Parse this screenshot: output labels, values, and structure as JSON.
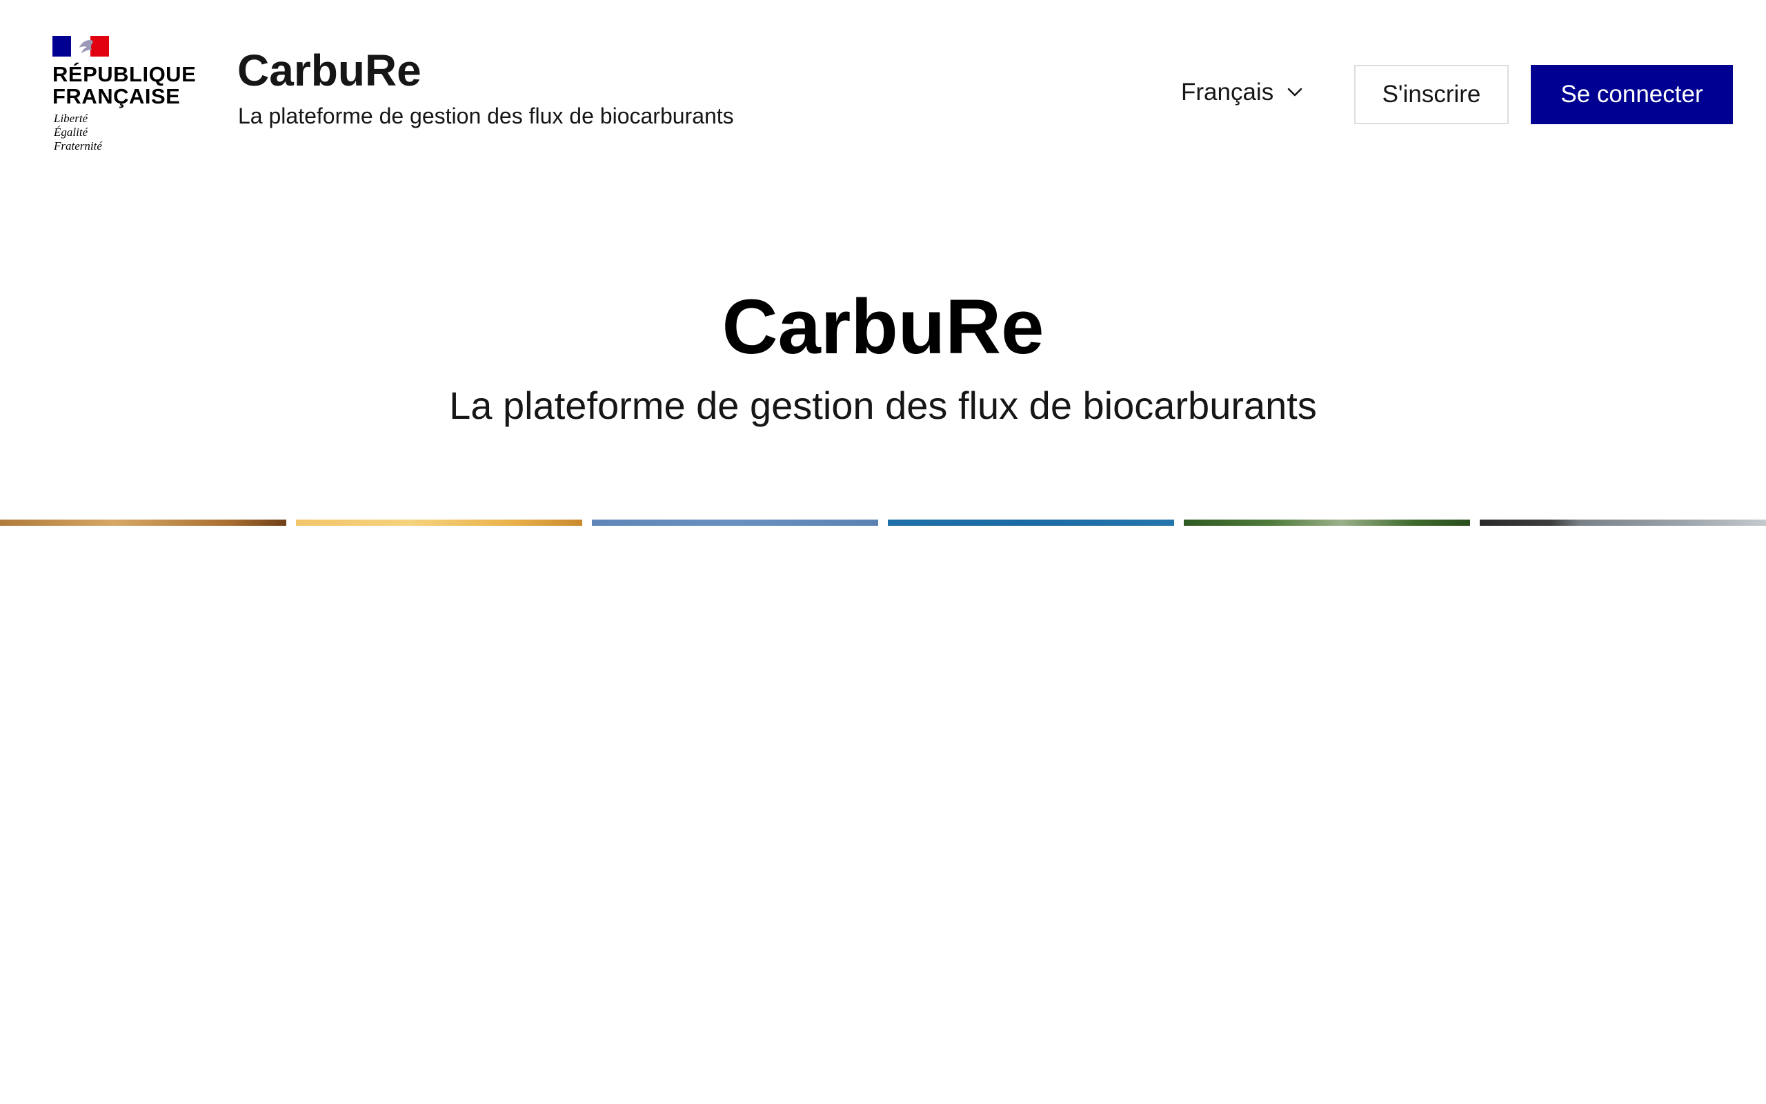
{
  "header": {
    "brand": {
      "line1": "RÉPUBLIQUE",
      "line2": "FRANÇAISE",
      "motto": [
        "Liberté",
        "Égalité",
        "Fraternité"
      ],
      "flag_colors": [
        "#000091",
        "#ffffff",
        "#e1000f"
      ]
    },
    "service_title": "CarbuRe",
    "service_tagline": "La plateforme de gestion des flux de biocarburants",
    "language_selector": {
      "selected": "Français",
      "icon": "chevron-down-icon"
    },
    "register_label": "S'inscrire",
    "login_label": "Se connecter",
    "accent_color": "#000091"
  },
  "hero": {
    "title": "CarbuRe",
    "tagline": "La plateforme de gestion des flux de biocarburants"
  },
  "image_strip": {
    "tiles": [
      {
        "subject": "wood-image"
      },
      {
        "subject": "grain-image"
      },
      {
        "subject": "sky-image"
      },
      {
        "subject": "water-image"
      },
      {
        "subject": "plants-image"
      },
      {
        "subject": "industry-image"
      }
    ]
  }
}
